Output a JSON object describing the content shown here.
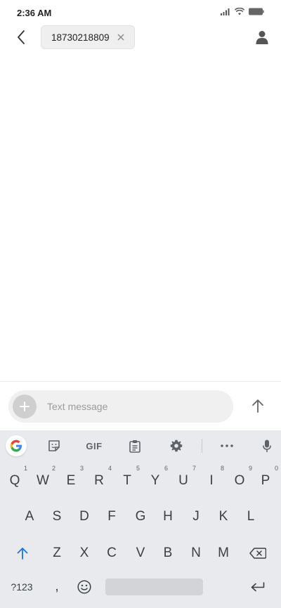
{
  "status_bar": {
    "time": "2:36 AM"
  },
  "header": {
    "recipient": "18730218809"
  },
  "compose": {
    "placeholder": "Text message"
  },
  "keyboard": {
    "toolbar": {
      "gif_label": "GIF",
      "icons": [
        "google-logo-icon",
        "sticker-icon",
        "gif-icon",
        "clipboard-icon",
        "settings-icon",
        "more-icon",
        "mic-icon"
      ]
    },
    "row1": [
      {
        "key": "Q",
        "hint": "1"
      },
      {
        "key": "W",
        "hint": "2"
      },
      {
        "key": "E",
        "hint": "3"
      },
      {
        "key": "R",
        "hint": "4"
      },
      {
        "key": "T",
        "hint": "5"
      },
      {
        "key": "Y",
        "hint": "6"
      },
      {
        "key": "U",
        "hint": "7"
      },
      {
        "key": "I",
        "hint": "8"
      },
      {
        "key": "O",
        "hint": "9"
      },
      {
        "key": "P",
        "hint": "0"
      }
    ],
    "row2": [
      "A",
      "S",
      "D",
      "F",
      "G",
      "H",
      "J",
      "K",
      "L"
    ],
    "row3": [
      "Z",
      "X",
      "C",
      "V",
      "B",
      "N",
      "M"
    ],
    "symbols_label": "?123",
    "comma_label": ",",
    "accent_color": "#1a73e8"
  }
}
